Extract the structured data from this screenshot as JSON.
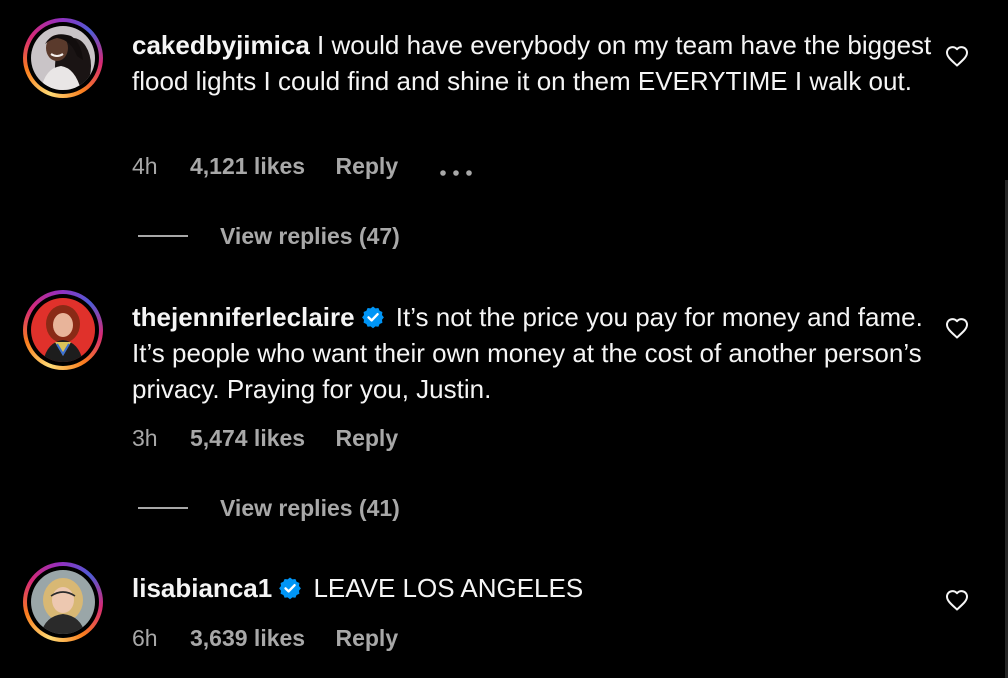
{
  "comments": [
    {
      "username": "cakedbyjimica",
      "verified": false,
      "text": "I would have everybody on my team have the biggest flood lights I could find and shine it on them EVERYTIME I walk out.",
      "time": "4h",
      "likes": "4,121 likes",
      "reply_label": "Reply",
      "view_replies": "View replies (47)",
      "icons": [
        "more-icon",
        "heart-icon"
      ]
    },
    {
      "username": "thejenniferleclaire",
      "verified": true,
      "text": "It’s not the price you pay for money and fame. It’s people who want their own money at the cost of another person’s privacy. Praying for you, Justin.",
      "time": "3h",
      "likes": "5,474 likes",
      "reply_label": "Reply",
      "view_replies": "View replies (41)",
      "icons": [
        "verified-badge-icon",
        "heart-icon"
      ]
    },
    {
      "username": "lisabianca1",
      "verified": true,
      "text": "LEAVE LOS ANGELES",
      "time": "6h",
      "likes": "3,639 likes",
      "reply_label": "Reply",
      "icons": [
        "verified-badge-icon",
        "heart-icon"
      ]
    }
  ],
  "colors": {
    "background": "#000000",
    "primary_text": "#f5f5f5",
    "secondary_text": "#a8a8a8",
    "verified_blue": "#0095f6"
  }
}
